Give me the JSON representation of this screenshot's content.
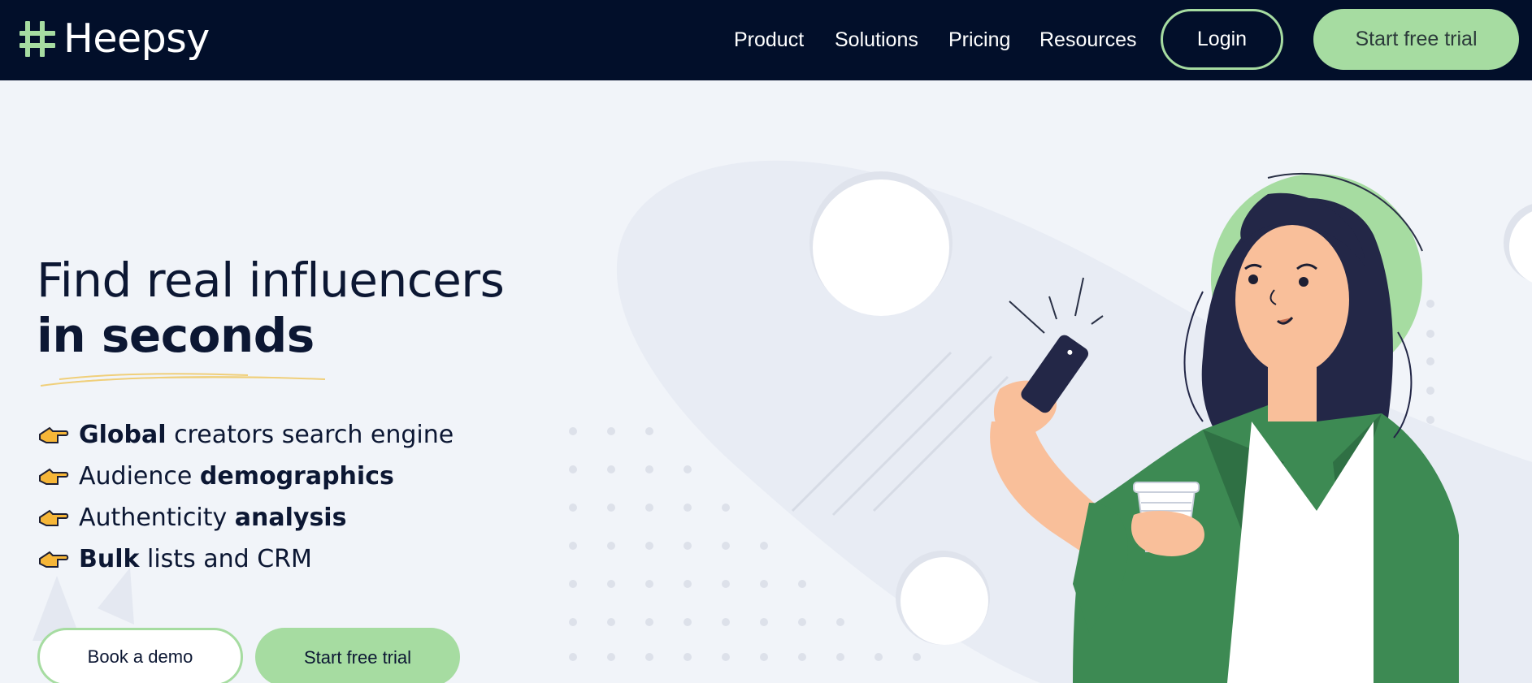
{
  "brand": {
    "name": "Heepsy",
    "accent": "#a6dca1",
    "navbar_bg": "#020f2a"
  },
  "nav": {
    "links": [
      "Product",
      "Solutions",
      "Pricing",
      "Resources"
    ],
    "login_label": "Login",
    "trial_label": "Start free trial"
  },
  "hero": {
    "headline_line1": "Find real influencers",
    "headline_line2": "in seconds",
    "features": [
      {
        "bold": "Global",
        "text": " creators search engine"
      },
      {
        "prefix": "Audience ",
        "bold": "demographics"
      },
      {
        "prefix": "Authenticity ",
        "bold": "analysis"
      },
      {
        "bold": "Bulk",
        "text": " lists and CRM"
      }
    ],
    "feature_icon": "pointing-hand-icon",
    "demo_label": "Book a demo",
    "trial_label": "Start free trial"
  }
}
